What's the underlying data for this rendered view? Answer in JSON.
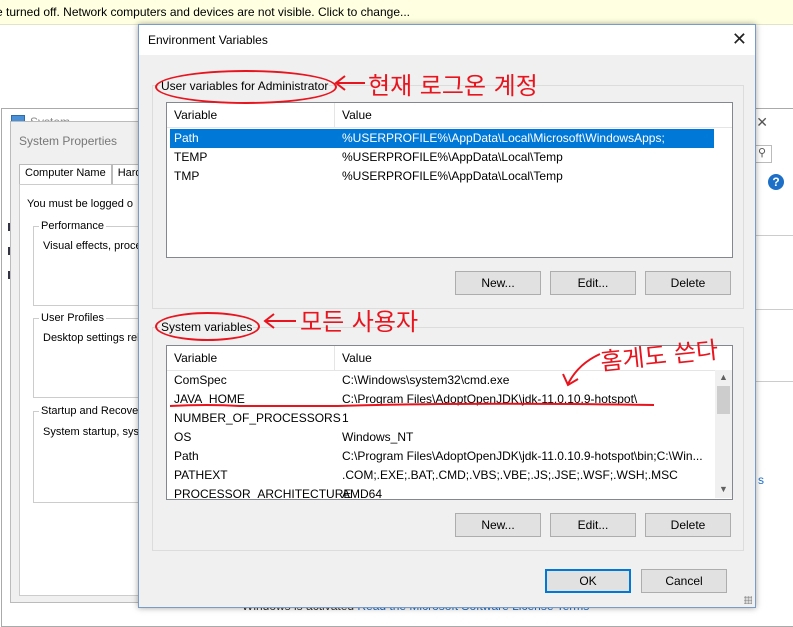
{
  "notification": {
    "text": "e turned off. Network computers and devices are not visible. Click to change..."
  },
  "system_window": {
    "title": "System",
    "bottom_status": "Windows is activated",
    "bottom_link": "Read the Microsoft Software License Terms",
    "side_link": "s"
  },
  "system_properties": {
    "title": "System Properties",
    "tabs": [
      "Computer Name",
      "Hardw"
    ],
    "message": "You must be logged o",
    "groups": [
      {
        "label": "Performance",
        "text": "Visual effects, proce"
      },
      {
        "label": "User Profiles",
        "text": "Desktop settings rela"
      },
      {
        "label": "Startup and Recover",
        "text": "System startup, syste"
      }
    ]
  },
  "env_dialog": {
    "title": "Environment Variables",
    "user_section": {
      "label": "User variables for Administrator",
      "columns": [
        "Variable",
        "Value"
      ],
      "rows": [
        {
          "variable": "Path",
          "value": "%USERPROFILE%\\AppData\\Local\\Microsoft\\WindowsApps;",
          "selected": true
        },
        {
          "variable": "TEMP",
          "value": "%USERPROFILE%\\AppData\\Local\\Temp",
          "selected": false
        },
        {
          "variable": "TMP",
          "value": "%USERPROFILE%\\AppData\\Local\\Temp",
          "selected": false
        }
      ],
      "buttons": {
        "new": "New...",
        "edit": "Edit...",
        "delete": "Delete"
      }
    },
    "system_section": {
      "label": "System variables",
      "columns": [
        "Variable",
        "Value"
      ],
      "rows": [
        {
          "variable": "ComSpec",
          "value": "C:\\Windows\\system32\\cmd.exe"
        },
        {
          "variable": "JAVA_HOME",
          "value": "C:\\Program Files\\AdoptOpenJDK\\jdk-11.0.10.9-hotspot\\"
        },
        {
          "variable": "NUMBER_OF_PROCESSORS",
          "value": "1"
        },
        {
          "variable": "OS",
          "value": "Windows_NT"
        },
        {
          "variable": "Path",
          "value": "C:\\Program Files\\AdoptOpenJDK\\jdk-11.0.10.9-hotspot\\bin;C:\\Win..."
        },
        {
          "variable": "PATHEXT",
          "value": ".COM;.EXE;.BAT;.CMD;.VBS;.VBE;.JS;.JSE;.WSF;.WSH;.MSC"
        },
        {
          "variable": "PROCESSOR_ARCHITECTURE",
          "value": "AMD64"
        }
      ],
      "buttons": {
        "new": "New...",
        "edit": "Edit...",
        "delete": "Delete"
      }
    },
    "footer_buttons": {
      "ok": "OK",
      "cancel": "Cancel"
    }
  },
  "annotations": {
    "user_note": "현재 로그온 계정",
    "system_note": "모든 사용자",
    "java_note": "홈게도 쓴다"
  },
  "colors": {
    "selection": "#0078d7",
    "annotation": "#e8141e",
    "notification_bg": "#ffffe1",
    "link": "#1e6fc8"
  },
  "icons": [
    "close-icon",
    "search-icon",
    "help-icon",
    "scroll-up-icon",
    "scroll-down-icon",
    "resize-grip-icon",
    "arrow-left-annotation-icon",
    "arrow-down-annotation-icon"
  ]
}
